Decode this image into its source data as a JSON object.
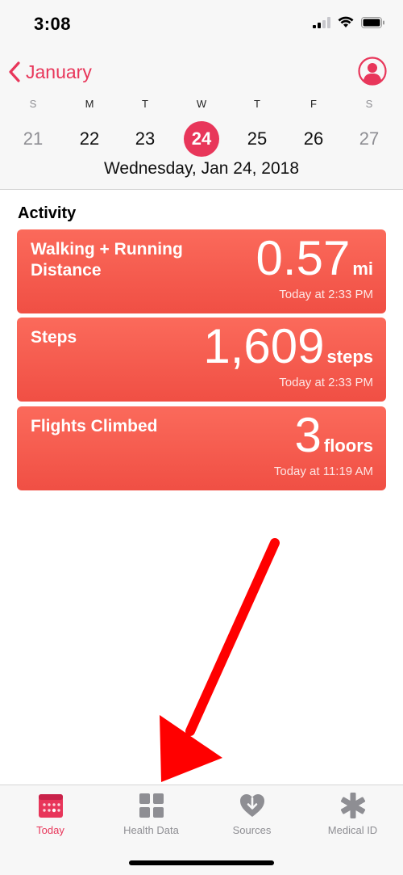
{
  "status": {
    "time": "3:08"
  },
  "nav": {
    "back_label": "January"
  },
  "week": {
    "days": [
      {
        "letter": "S",
        "num": "21"
      },
      {
        "letter": "M",
        "num": "22"
      },
      {
        "letter": "T",
        "num": "23"
      },
      {
        "letter": "W",
        "num": "24"
      },
      {
        "letter": "T",
        "num": "25"
      },
      {
        "letter": "F",
        "num": "26"
      },
      {
        "letter": "S",
        "num": "27"
      }
    ],
    "selected_day": "24",
    "full_date": "Wednesday, Jan 24, 2018"
  },
  "activity": {
    "title": "Activity",
    "cards": [
      {
        "title": "Walking + Running Distance",
        "value": "0.57",
        "unit": "mi",
        "time": "Today at 2:33 PM"
      },
      {
        "title": "Steps",
        "value": "1,609",
        "unit": "steps",
        "time": "Today at 2:33 PM"
      },
      {
        "title": "Flights Climbed",
        "value": "3",
        "unit": "floors",
        "time": "Today at 11:19 AM"
      }
    ]
  },
  "tabs": [
    {
      "label": "Today",
      "icon": "calendar-icon",
      "active": true
    },
    {
      "label": "Health Data",
      "icon": "grid-icon",
      "active": false
    },
    {
      "label": "Sources",
      "icon": "heart-download-icon",
      "active": false
    },
    {
      "label": "Medical ID",
      "icon": "asterisk-icon",
      "active": false
    }
  ],
  "colors": {
    "accent": "#e8365a",
    "card": "#f35a4d",
    "annotation_arrow": "#ff0000"
  }
}
